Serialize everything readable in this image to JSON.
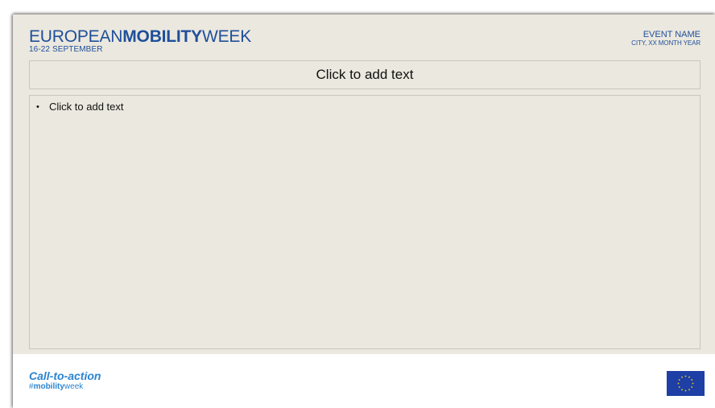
{
  "header": {
    "logo_prefix": "EUROPEAN",
    "logo_bold": "MOBILITY",
    "logo_suffix": "WEEK",
    "dates": "16-22 SEPTEMBER",
    "event_name": "EVENT NAME",
    "event_place": "CITY, XX MONTH YEAR"
  },
  "slide": {
    "title_placeholder": "Click to add text",
    "bullet_marker": "•",
    "bullet_placeholder": "Click to add text"
  },
  "footer": {
    "cta": "Call-to-action",
    "hashtag_prefix": "#",
    "hashtag_bold": "mobility",
    "hashtag_suffix": "week",
    "flag_icon": "eu-flag-icon"
  },
  "colors": {
    "brand_blue": "#1f4f9a",
    "cta_blue": "#2a84d0",
    "slide_background": "#ebe8df",
    "eu_blue": "#1e3fa6",
    "eu_star": "#f4d500"
  }
}
